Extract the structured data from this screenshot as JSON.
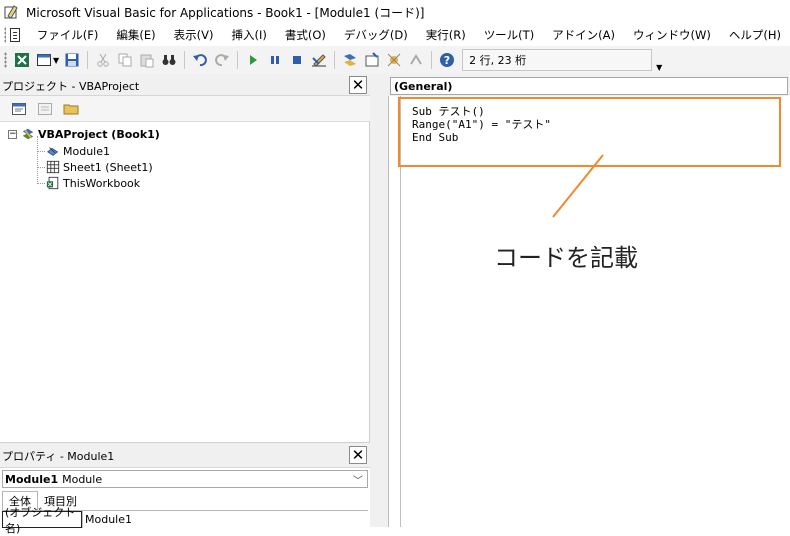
{
  "window": {
    "title": "Microsoft Visual Basic for Applications - Book1 - [Module1 (コード)]"
  },
  "menu": {
    "items": [
      "ファイル(F)",
      "編集(E)",
      "表示(V)",
      "挿入(I)",
      "書式(O)",
      "デバッグ(D)",
      "実行(R)",
      "ツール(T)",
      "アドイン(A)",
      "ウィンドウ(W)",
      "ヘルプ(H)"
    ]
  },
  "toolbar": {
    "position_status": "2 行, 23 桁"
  },
  "project": {
    "title": "プロジェクト - VBAProject",
    "close_label": "✕",
    "tree": {
      "root": "VBAProject (Book1)",
      "children": [
        "Module1",
        "Sheet1 (Sheet1)",
        "ThisWorkbook"
      ]
    }
  },
  "properties": {
    "title": "プロパティ - Module1",
    "close_label": "✕",
    "object_name": "Module1",
    "object_type": "Module",
    "tabs": [
      "全体",
      "項目別"
    ],
    "rows": [
      {
        "name": "(オブジェクト名)",
        "value": "Module1"
      }
    ]
  },
  "code": {
    "object_combo": "(General)",
    "lines": [
      "Sub テスト()",
      "Range(\"A1\") = \"テスト\"",
      "End Sub"
    ]
  },
  "annotation": {
    "label": "コードを記載",
    "color": "#f08a2c"
  }
}
